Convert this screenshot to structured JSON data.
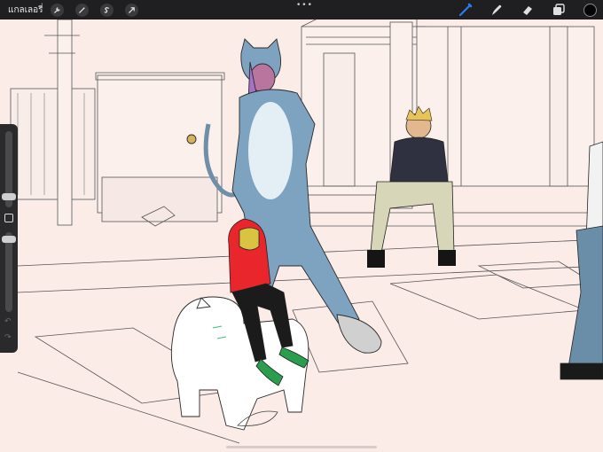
{
  "toolbar": {
    "gallery_label": "แกลเลอรี่",
    "left_tools": [
      "wrench-icon",
      "magic-wand-icon",
      "selection-icon",
      "transform-arrow-icon"
    ],
    "more_label": "•••",
    "right_tools": [
      "brush-icon",
      "smudge-icon",
      "eraser-icon",
      "layers-icon"
    ],
    "active_tool": "brush-icon",
    "current_color": "#050505",
    "accent_color": "#2e7cf6"
  },
  "canvas": {
    "background": "#fbece8"
  },
  "sidebar": {
    "brush_size_level": 0.55,
    "opacity_level": 0.9
  }
}
